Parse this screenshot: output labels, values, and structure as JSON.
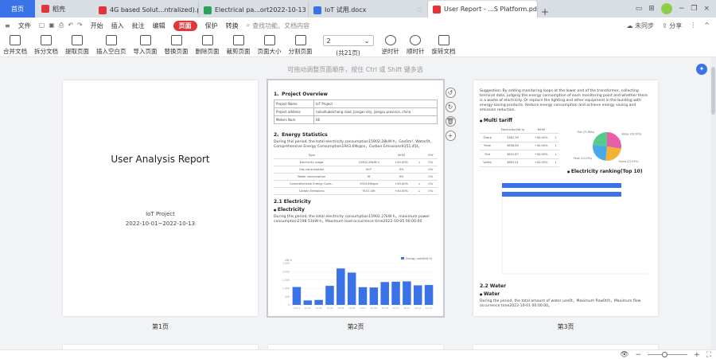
{
  "tabs": {
    "home": "首页",
    "daoke": "稻壳",
    "items": [
      {
        "label": "4G based Solut...ntralized).pdf",
        "color": "#e0353a"
      },
      {
        "label": "Electrical pa...ort2022-10-13",
        "color": "#2aa35a"
      },
      {
        "label": "IoT 试用.docx",
        "color": "#3a73e8"
      },
      {
        "label": "User Report - ...S Platform.pdf",
        "color": "#e0353a"
      }
    ],
    "plus": "+"
  },
  "menu": {
    "file": "文件",
    "items": [
      "开始",
      "插入",
      "批注",
      "编辑",
      "页面",
      "保护",
      "转换"
    ],
    "active": "页面",
    "search_placeholder": "查找功能、文档内容",
    "sync": "未同步",
    "share": "分享"
  },
  "ribbon": {
    "buttons": [
      "合并文档",
      "拆分文档",
      "提取页面",
      "插入空白页",
      "导入页面",
      "替换页面",
      "删除页面",
      "裁剪页面",
      "页面大小",
      "分割页面"
    ],
    "page_value": "2",
    "page_count": "(共21页)",
    "rotate_left": "逆时针",
    "rotate_right": "顺时针",
    "rotate_doc": "旋转文档"
  },
  "hint": "可拖动调整页面顺序，按住 Ctrl 或 Shift 键多选",
  "pages": {
    "p1": {
      "title": "User Analysis Report",
      "project": "IoT Project",
      "dates": "2022-10-01~2022-10-13",
      "label": "第1页"
    },
    "p2": {
      "label": "第2页",
      "overview_heading": "1、Project Overview",
      "overview_rows": [
        [
          "Project Name",
          "IoT Project"
        ],
        [
          "Project address",
          "ruikuillubeichang road, jiangan city, jiangsu province, china"
        ],
        [
          "Meters Num",
          "66"
        ]
      ],
      "energy_heading": "2、Energy Statistics",
      "energy_para": "During this period, the total electricity consumption15902.28kW·h，Gas0m³, Water0t, Comprehensive Energy Consumption1943.69kgce，Carbon Emissions9151.45t。",
      "energy_table_head": [
        "Type",
        "MOM",
        "YOY"
      ],
      "energy_table_rows": [
        [
          "Electricity usage",
          "15902.28kW·h",
          "+40.00%",
          "↓",
          "0%"
        ],
        [
          "Gas consumption",
          "0m³",
          "0%",
          "",
          "0%"
        ],
        [
          "Water consumption",
          "0t",
          "0%",
          "",
          "0%"
        ],
        [
          "Comprehensive Energy Cons...",
          "1943.69kgce",
          "+40.00%",
          "↓",
          "0%"
        ],
        [
          "Carbon Emissions",
          "9151.45t",
          "+40.00%",
          "↓",
          "0%"
        ]
      ],
      "electricity_heading": "2.1 Electricity",
      "electricity_bullet": "Electricity",
      "electricity_para": "During this period, the total electricity consumption15902.27kW·h，maximum power consumption2198.51kW·h，Maximum load occurrence time2022-10-05 00:00:00"
    },
    "p3": {
      "label": "第3页",
      "suggestion": "Suggestion: By adding monitoring loops at the lower end of the transformer, collecting terminal data, judging the energy consumption of each monitoring point and whether there is a waste of electricity. Or replace the lighting and other equipment in the building with energy-saving products. Reduce energy consumption and achieve energy saving and emission reduction.",
      "multi_tariff": "Multi tariff",
      "tariff_head": [
        "",
        "Electricity(kW·h)",
        "MOM",
        ""
      ],
      "tariff_rows": [
        [
          "Sharp",
          "3381.30",
          "+40.00%",
          "↓"
        ],
        [
          "Peak",
          "3658.80",
          "+40.00%",
          "↓"
        ],
        [
          "Flat",
          "3801.67",
          "+40.00%",
          "↓"
        ],
        [
          "Valley",
          "3861.51",
          "+40.00%",
          "↓"
        ]
      ],
      "ranking_heading": "Electricity ranking(Top 10)",
      "water_heading": "2.2 Water",
      "water_bullet": "Water",
      "water_para": "During the period, the total amount of water use0t，Maximum flow0t/h，Maximum flow occurrence time2022-10-01 00:00:00。"
    }
  },
  "chart_data": [
    {
      "type": "bar",
      "legend": "Energy used(kW·h)",
      "ylabel": "kW·h",
      "ylim": [
        0,
        2500
      ],
      "yticks": [
        "2,500",
        "2,000",
        "1,500",
        "1,000",
        "500",
        "0"
      ],
      "categories": [
        "10-01",
        "10-02",
        "10-03",
        "10-04",
        "10-05",
        "10-06",
        "10-07",
        "10-08",
        "10-09",
        "10-10",
        "10-11",
        "10-12",
        "10-13"
      ],
      "values": [
        1080,
        270,
        300,
        1150,
        2200,
        1950,
        1070,
        1050,
        1380,
        1400,
        1420,
        1180,
        1200
      ],
      "color": "#3a73e8"
    },
    {
      "type": "pie",
      "slices": [
        {
          "name": "Valley (26.20%)",
          "value": 26.2,
          "color": "#e85fa8"
        },
        {
          "name": "Sharp (22.93%)",
          "value": 22.93,
          "color": "#f2b233"
        },
        {
          "name": "Peak (24.23%)",
          "value": 24.23,
          "color": "#4aa9e8"
        },
        {
          "name": "Flat (21.86%)",
          "value": 21.86,
          "color": "#58c98c"
        }
      ]
    }
  ],
  "status": {
    "zoom_minus": "−",
    "zoom_plus": "+"
  }
}
